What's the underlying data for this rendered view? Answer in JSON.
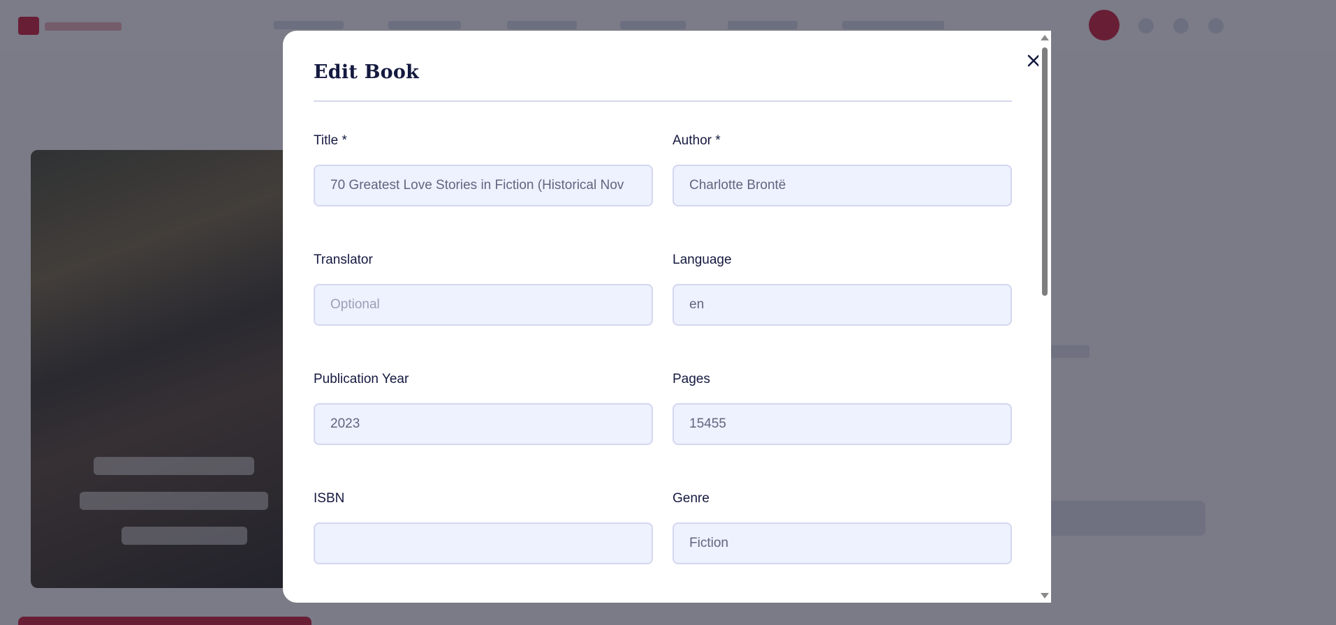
{
  "modal": {
    "title": "Edit Book",
    "close_icon": "close-icon",
    "fields": {
      "title": {
        "label": "Title *",
        "value": "70 Greatest Love Stories in Fiction (Historical Nov",
        "placeholder": ""
      },
      "author": {
        "label": "Author *",
        "value": "Charlotte Brontë",
        "placeholder": ""
      },
      "translator": {
        "label": "Translator",
        "value": "",
        "placeholder": "Optional"
      },
      "language": {
        "label": "Language",
        "value": "en",
        "placeholder": ""
      },
      "publication_year": {
        "label": "Publication Year",
        "value": "2023",
        "placeholder": ""
      },
      "pages": {
        "label": "Pages",
        "value": "15455",
        "placeholder": ""
      },
      "isbn": {
        "label": "ISBN",
        "value": "",
        "placeholder": ""
      },
      "genre": {
        "label": "Genre",
        "value": "Fiction",
        "placeholder": ""
      }
    }
  },
  "colors": {
    "brand": "#c8102e",
    "heading": "#14193f",
    "input_bg": "#eef1fe",
    "input_border": "#d4d7ef"
  }
}
